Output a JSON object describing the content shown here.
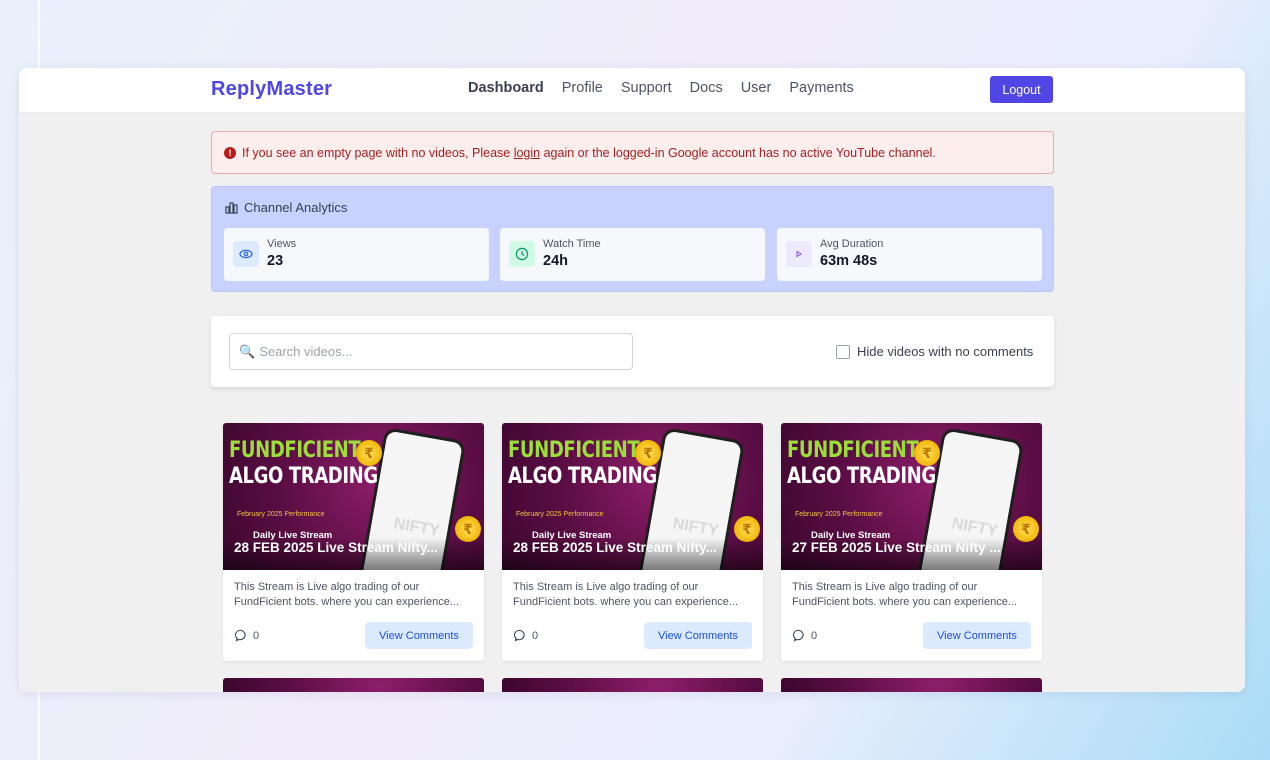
{
  "navbar": {
    "brand": "ReplyMaster",
    "links": [
      "Dashboard",
      "Profile",
      "Support",
      "Docs",
      "User",
      "Payments"
    ],
    "active": "Dashboard",
    "logout_label": "Logout"
  },
  "alert": {
    "text_before": "If you see an empty page with no videos, Please ",
    "link_text": "login",
    "text_after": " again or the logged-in Google account has no active YouTube channel."
  },
  "analytics": {
    "title": "Channel Analytics",
    "stats": [
      {
        "label": "Views",
        "value": "23",
        "icon": "eye-icon",
        "color": "#dbeafe"
      },
      {
        "label": "Watch Time",
        "value": "24h",
        "icon": "clock-icon",
        "color": "#d1fae5"
      },
      {
        "label": "Avg Duration",
        "value": "63m 48s",
        "icon": "play-icon",
        "color": "#ede9fe"
      }
    ]
  },
  "search": {
    "placeholder": "Search videos...",
    "value": "",
    "hide_label": "Hide videos with no comments",
    "hide_checked": false
  },
  "thumbnail_text": {
    "line1": "FUNDFICIENT",
    "line2": "ALGO TRADING",
    "line3": "February 2025 Performance",
    "line4": "Daily Live Stream",
    "phone": "NIFTY"
  },
  "videos": [
    {
      "title": "28 FEB 2025 Live Stream Nifty...",
      "desc1": "This Stream is Live algo trading of our",
      "desc2": "FundFicient bots. where you can experience...",
      "comments": "0",
      "button": "View Comments"
    },
    {
      "title": "28 FEB 2025 Live Stream Nifty...",
      "desc1": "This Stream is Live algo trading of our",
      "desc2": "FundFicient bots. where you can experience...",
      "comments": "0",
      "button": "View Comments"
    },
    {
      "title": "27 FEB 2025 Live Stream Nifty ...",
      "desc1": "This Stream is Live algo trading of our",
      "desc2": "FundFicient bots. where you can experience...",
      "comments": "0",
      "button": "View Comments"
    }
  ],
  "colors": {
    "brand": "#4f46e5",
    "alert_bg": "#fdeeee",
    "analytics_bg": "#c7d2fe"
  }
}
